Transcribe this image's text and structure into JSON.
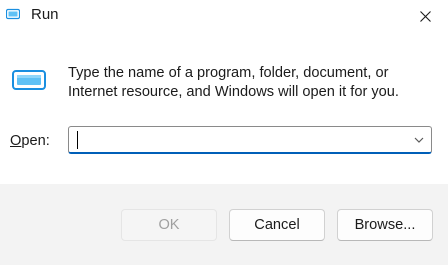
{
  "window": {
    "title": "Run",
    "title_icon": "run-icon",
    "close_icon": "close-icon"
  },
  "content": {
    "description_line1": "Type the name of a program, folder, document, or",
    "description_line2": "Internet resource, and Windows will open it for you.",
    "open_label_accel": "O",
    "open_label_rest": "pen:",
    "open_input": {
      "value": "",
      "placeholder": ""
    }
  },
  "buttons": {
    "ok_label": "OK",
    "ok_enabled": false,
    "cancel_label": "Cancel",
    "browse_label": "Browse..."
  },
  "colors": {
    "accent": "#005fb8",
    "footer_background": "#f3f3f3",
    "icon_blue": "#1a8fe0"
  }
}
